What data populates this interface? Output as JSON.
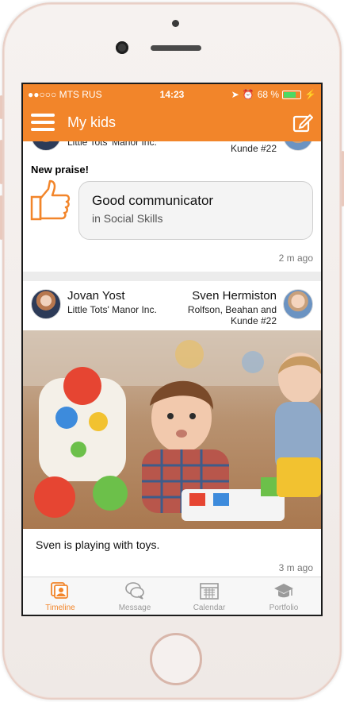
{
  "status_bar": {
    "carrier": "●●○○○ MTS RUS",
    "time": "14:23",
    "battery_percent": "68 %"
  },
  "nav": {
    "title": "My kids"
  },
  "card_praise": {
    "label": "New praise!",
    "praise_title": "Good communicator",
    "praise_category": "in Social Skills",
    "time_ago": "2 m ago",
    "partial_header_left": "Little Tots' Manor Inc.",
    "partial_header_right": "Kunde  #22"
  },
  "card_post": {
    "teacher_name": "Jovan Yost",
    "teacher_school": "Little Tots' Manor Inc.",
    "child_name": "Sven Hermiston",
    "child_school": "Rolfson, Beahan and Kunde  #22",
    "caption": "Sven is playing with toys.",
    "time_ago": "3 m ago"
  },
  "tabs": [
    {
      "label": "Timeline",
      "icon": "timeline-icon",
      "active": true
    },
    {
      "label": "Message",
      "icon": "message-icon",
      "active": false
    },
    {
      "label": "Calendar",
      "icon": "calendar-icon",
      "active": false
    },
    {
      "label": "Portfolio",
      "icon": "portfolio-icon",
      "active": false
    }
  ],
  "colors": {
    "accent": "#f2852a",
    "inactive_tab": "#9a9a9a"
  }
}
